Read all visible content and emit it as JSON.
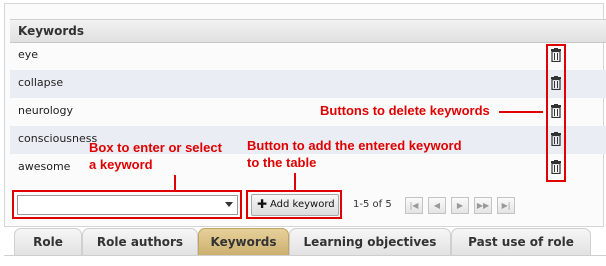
{
  "table": {
    "header": "Keywords",
    "rows": [
      {
        "keyword": "eye"
      },
      {
        "keyword": "collapse"
      },
      {
        "keyword": "neurology"
      },
      {
        "keyword": "consciousness"
      },
      {
        "keyword": "awesome"
      }
    ]
  },
  "annotations": {
    "delete_label": "Buttons to delete keywords",
    "box_label_line1": "Box to enter or select",
    "box_label_line2": "a keyword",
    "add_label_line1": "Button to add the entered keyword",
    "add_label_line2": "to the table"
  },
  "controls": {
    "keyword_input_value": "",
    "add_button_label": "Add keyword",
    "add_icon": "plus-icon",
    "pager_text": "1-5 of 5"
  },
  "tabs": [
    {
      "label": "Role"
    },
    {
      "label": "Role authors"
    },
    {
      "label": "Keywords",
      "active": true
    },
    {
      "label": "Learning objectives"
    },
    {
      "label": "Past use of role"
    }
  ],
  "colors": {
    "annotation": "#e00000",
    "active_tab": "#d9bf84",
    "row_alt": "#eaedf3"
  }
}
